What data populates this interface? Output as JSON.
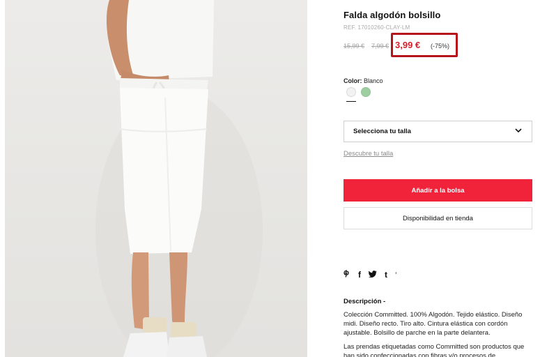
{
  "product": {
    "title": "Falda algodón bolsillo",
    "ref": "REF. 17010260-CLAY-LM",
    "old_price_1": "15,99 €",
    "old_price_2": "7,99 €",
    "price": "3,99 €",
    "discount": "(-75%)"
  },
  "color": {
    "label": "Color:",
    "value": "Blanco",
    "swatches": [
      {
        "name": "Blanco",
        "hex": "#f2f2f2"
      },
      {
        "name": "Verde",
        "hex": "#9fcea3"
      }
    ]
  },
  "size": {
    "select_label": "Selecciona tu talla",
    "guide_link": "Descubre tu talla"
  },
  "actions": {
    "add_to_bag": "Añadir a la bolsa",
    "store_availability": "Disponibilidad en tienda"
  },
  "share": {
    "icons": [
      "pinterest-icon",
      "facebook-icon",
      "twitter-icon",
      "tumblr-icon"
    ],
    "glyphs": [
      "℗",
      "f",
      "🐦",
      "t"
    ]
  },
  "description": {
    "title": "Descripción -",
    "text": "Colección Committed. 100% Algodón. Tejido elástico. Diseño midi. Diseño recto. Tiro alto. Cintura elástica con cordón ajustable. Bolsillo de parche en la parte delantera.",
    "text2": "Las prendas etiquetadas como Committed son productos que han sido confeccionadas con fibras y/o procesos de"
  },
  "colors": {
    "accent": "#f0233b",
    "price": "#d41f2b",
    "highlight_box": "#b4141a"
  }
}
